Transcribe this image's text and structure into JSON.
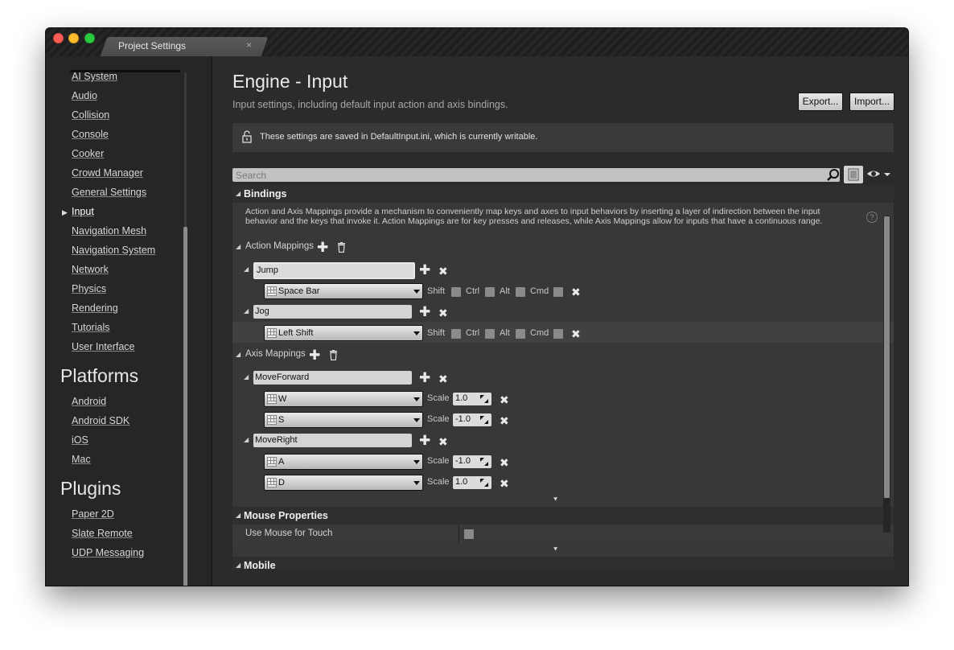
{
  "window": {
    "tab_title": "Project Settings",
    "tab_close": "×"
  },
  "sidebar": {
    "items": [
      "AI System",
      "Audio",
      "Collision",
      "Console",
      "Cooker",
      "Crowd Manager",
      "General Settings",
      "Input",
      "Navigation Mesh",
      "Navigation System",
      "Network",
      "Physics",
      "Rendering",
      "Tutorials",
      "User Interface"
    ],
    "selected": "Input",
    "platforms_header": "Platforms",
    "platforms": [
      "Android",
      "Android SDK",
      "iOS",
      "Mac"
    ],
    "plugins_header": "Plugins",
    "plugins": [
      "Paper 2D",
      "Slate Remote",
      "UDP Messaging"
    ]
  },
  "main": {
    "title": "Engine - Input",
    "subtitle": "Input settings, including default input action and axis bindings.",
    "export_label": "Export...",
    "import_label": "Import...",
    "notice": "These settings are saved in DefaultInput.ini, which is currently writable.",
    "search_placeholder": "Search"
  },
  "bindings": {
    "header": "Bindings",
    "description": "Action and Axis Mappings provide a mechanism to conveniently map keys and axes to input behaviors by inserting a layer of indirection between the input behavior and the keys that invoke it. Action Mappings are for key presses and releases, while Axis Mappings allow for inputs that have a continuous range.",
    "help": "?",
    "action_label": "Action Mappings",
    "axis_label": "Axis Mappings",
    "modifiers": [
      "Shift",
      "Ctrl",
      "Alt",
      "Cmd"
    ],
    "scale_label": "Scale",
    "actions": [
      {
        "name": "Jump",
        "key": "Space Bar"
      },
      {
        "name": "Jog",
        "key": "Left Shift"
      }
    ],
    "axes": [
      {
        "name": "MoveForward",
        "keys": [
          {
            "key": "W",
            "scale": "1.0"
          },
          {
            "key": "S",
            "scale": "-1.0"
          }
        ]
      },
      {
        "name": "MoveRight",
        "keys": [
          {
            "key": "A",
            "scale": "-1.0"
          },
          {
            "key": "D",
            "scale": "1.0"
          }
        ]
      }
    ]
  },
  "mouse": {
    "header": "Mouse Properties",
    "use_mouse_for_touch": "Use Mouse for Touch"
  },
  "mobile": {
    "header": "Mobile"
  },
  "icons": {
    "plus": "plus-icon",
    "remove": "remove-icon",
    "trash": "trash-icon",
    "search": "search-icon",
    "eye": "eye-icon",
    "lock": "unlock-icon",
    "expand": "chevron-down-icon"
  }
}
